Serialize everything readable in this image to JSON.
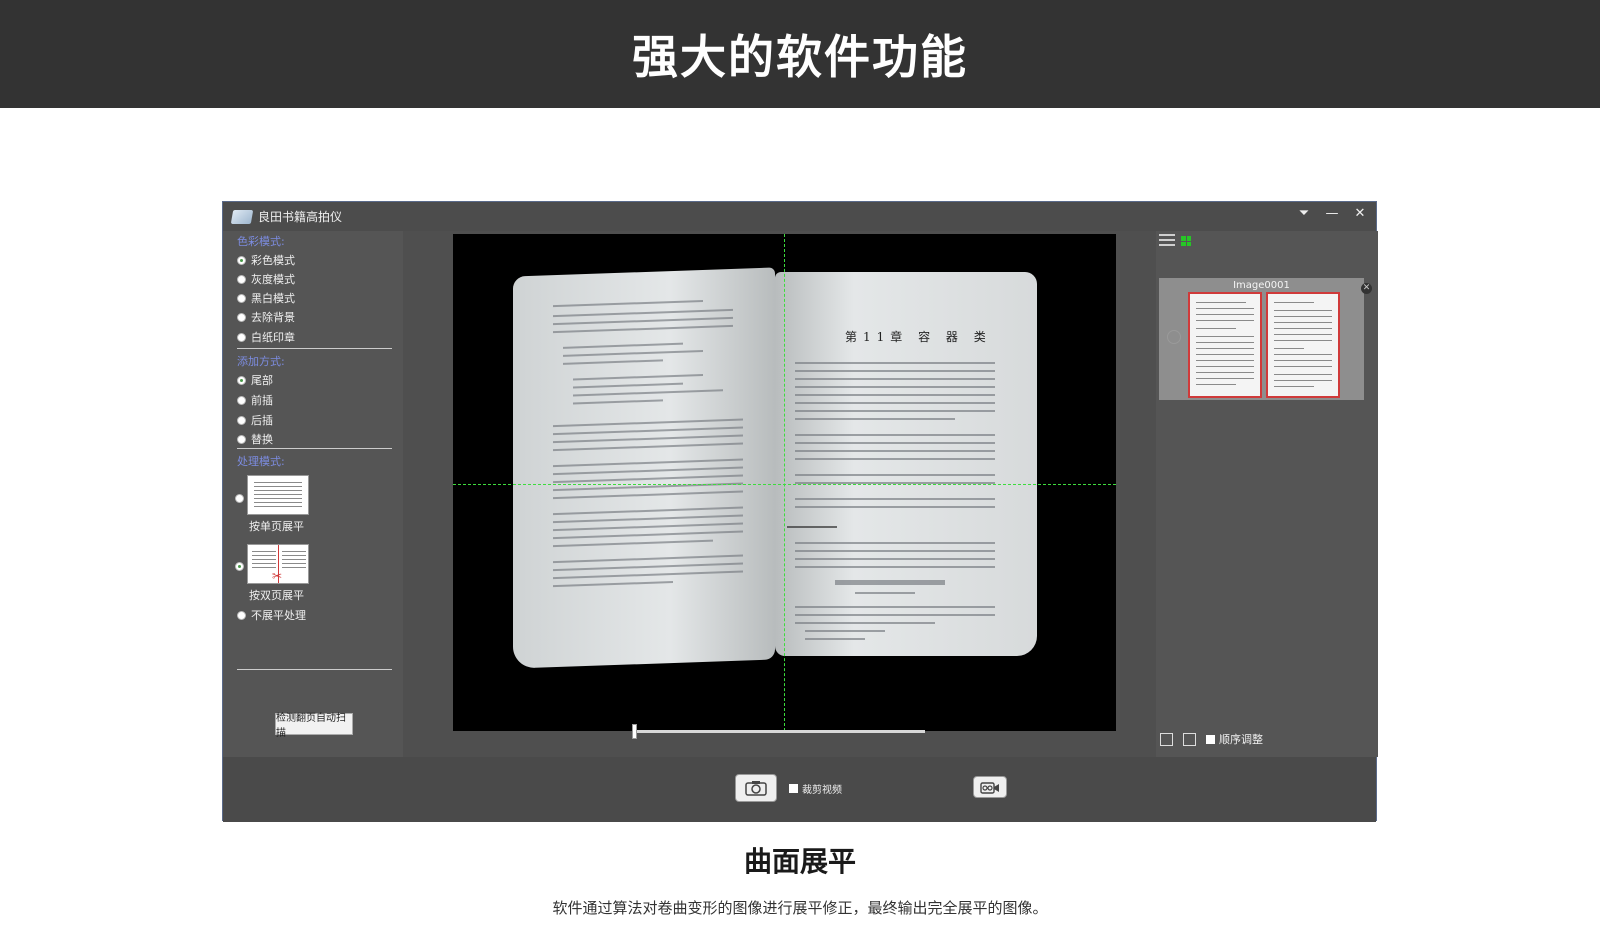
{
  "banner": {
    "title": "强大的软件功能"
  },
  "app": {
    "title": "良田书籍高拍仪",
    "window_controls": {
      "dropdown": "⏷",
      "minimize": "—",
      "close": "✕"
    },
    "color_mode": {
      "label": "色彩模式:",
      "options": [
        "彩色模式",
        "灰度模式",
        "黑白模式",
        "去除背景",
        "白纸印章"
      ],
      "selected": "彩色模式"
    },
    "add_mode": {
      "label": "添加方式:",
      "options": [
        "尾部",
        "前插",
        "后插",
        "替换"
      ],
      "selected": "尾部"
    },
    "process_mode": {
      "label": "处理模式:",
      "single_page": "按单页展平",
      "double_page": "按双页展平",
      "no_flatten": "不展平处理",
      "selected": "按双页展平"
    },
    "detect_button": "检测翻页自动扫描",
    "preview": {
      "chapter_heading": "第11章 容 器 类"
    },
    "thumbnails": [
      {
        "name": "Image0001"
      }
    ],
    "order_adjust_label": "顺序调整",
    "crop_video_label": "裁剪视频",
    "icons": {
      "list_view": "list-view-icon",
      "grid_view": "grid-view-icon",
      "camera": "camera-icon",
      "video": "video-record-icon",
      "delete": "trash-icon",
      "detail_list": "detail-list-icon"
    },
    "colors": {
      "guide": "#3ddc3d",
      "selection": "#d03a3a",
      "group_title": "#7c8ce0"
    }
  },
  "feature": {
    "title": "曲面展平",
    "description": "软件通过算法对卷曲变形的图像进行展平修正，最终输出完全展平的图像。"
  }
}
